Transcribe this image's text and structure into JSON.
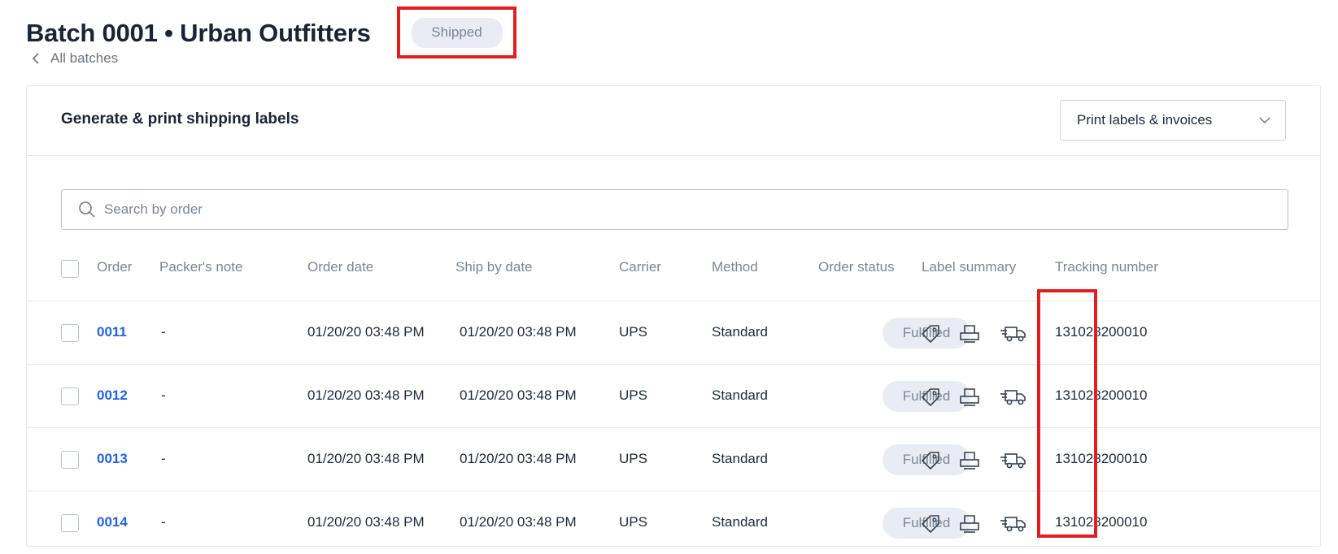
{
  "header": {
    "title": "Batch 0001 • Urban Outfitters",
    "status": "Shipped",
    "back_label": "All batches"
  },
  "card": {
    "title": "Generate & print shipping labels",
    "print_button": "Print labels & invoices"
  },
  "search": {
    "placeholder": "Search by order"
  },
  "table": {
    "columns": [
      "Order",
      "Packer's note",
      "Order date",
      "Ship by date",
      "Carrier",
      "Method",
      "Order status",
      "Label summary",
      "Tracking number"
    ],
    "rows": [
      {
        "order": "0011",
        "note": "-",
        "order_date": "01/20/20 03:48 PM",
        "ship_by": "01/20/20 03:48 PM",
        "carrier": "UPS",
        "method": "Standard",
        "status": "Fulfilled",
        "tracking": "131028200010"
      },
      {
        "order": "0012",
        "note": "-",
        "order_date": "01/20/20 03:48 PM",
        "ship_by": "01/20/20 03:48 PM",
        "carrier": "UPS",
        "method": "Standard",
        "status": "Fulfilled",
        "tracking": "131028200010"
      },
      {
        "order": "0013",
        "note": "-",
        "order_date": "01/20/20 03:48 PM",
        "ship_by": "01/20/20 03:48 PM",
        "carrier": "UPS",
        "method": "Standard",
        "status": "Fulfilled",
        "tracking": "131028200010"
      },
      {
        "order": "0014",
        "note": "-",
        "order_date": "01/20/20 03:48 PM",
        "ship_by": "01/20/20 03:48 PM",
        "carrier": "UPS",
        "method": "Standard",
        "status": "Fulfilled",
        "tracking": "131028200010"
      }
    ]
  },
  "icons": {
    "back": "chevron-left-icon",
    "dropdown": "chevron-down-icon",
    "search": "search-icon",
    "label": "tag-icon",
    "print": "printer-icon",
    "ship": "truck-icon"
  },
  "colors": {
    "link": "#2563d9",
    "highlight": "#e02020",
    "pill_bg": "#e9edf3",
    "pill_text": "#7a8596"
  }
}
